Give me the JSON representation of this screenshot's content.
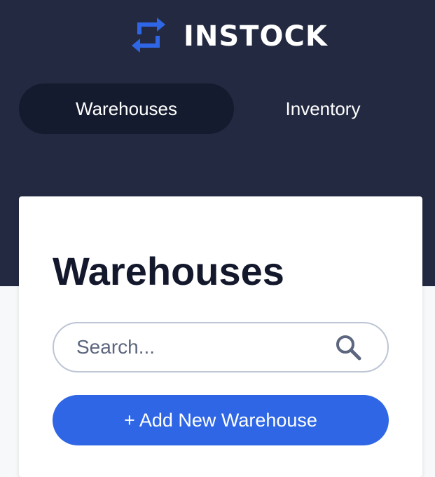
{
  "header": {
    "logo_text": "INSTOCK",
    "logo_icon": "swap-arrows-icon",
    "accent_color": "#2e66e5",
    "nav": [
      {
        "label": "Warehouses",
        "active": true
      },
      {
        "label": "Inventory",
        "active": false
      }
    ]
  },
  "main": {
    "title": "Warehouses",
    "search": {
      "placeholder": "Search...",
      "value": "",
      "icon": "search-icon"
    },
    "add_button_label": "+ Add New Warehouse"
  }
}
